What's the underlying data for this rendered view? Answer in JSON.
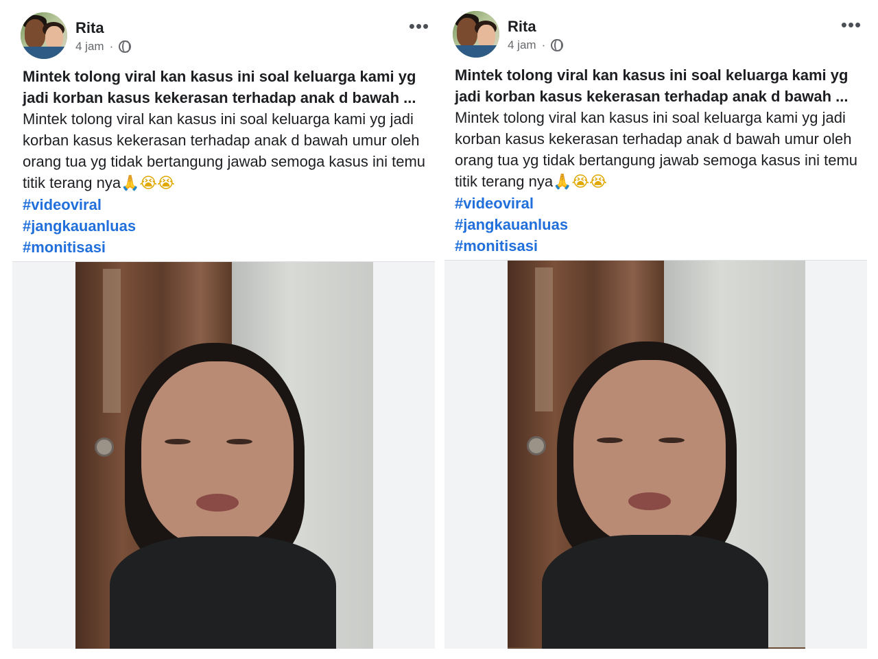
{
  "posts": [
    {
      "author": "Rita",
      "time": "4 jam",
      "separator": "·",
      "more": "•••",
      "title": "Mintek tolong viral kan kasus ini soal keluarga kami yg jadi korban kasus kekerasan terhadap anak d bawah ...",
      "body": "Mintek tolong viral kan kasus ini soal keluarga kami yg jadi korban kasus kekerasan terhadap anak d bawah umur oleh orang tua yg tidak bertangung jawab semoga kasus ini temu titik terang nya",
      "emojis": "🙏😭😭",
      "hashtags": [
        "#videoviral",
        "#jangkauanluas",
        "#monitisasi"
      ]
    },
    {
      "author": "Rita",
      "time": "4 jam",
      "separator": "·",
      "more": "•••",
      "title": "Mintek tolong viral kan kasus ini soal keluarga kami yg jadi korban kasus kekerasan terhadap anak d bawah ...",
      "body": "Mintek tolong viral kan kasus ini soal keluarga kami yg jadi korban kasus kekerasan terhadap anak d bawah umur oleh orang tua yg tidak bertangung jawab semoga kasus ini temu titik terang nya",
      "emojis": "🙏😭😭",
      "hashtags": [
        "#videoviral",
        "#jangkauanluas",
        "#monitisasi"
      ]
    }
  ],
  "colors": {
    "hashtag": "#216fdb",
    "text": "#1c1e21",
    "meta": "#65676b"
  }
}
